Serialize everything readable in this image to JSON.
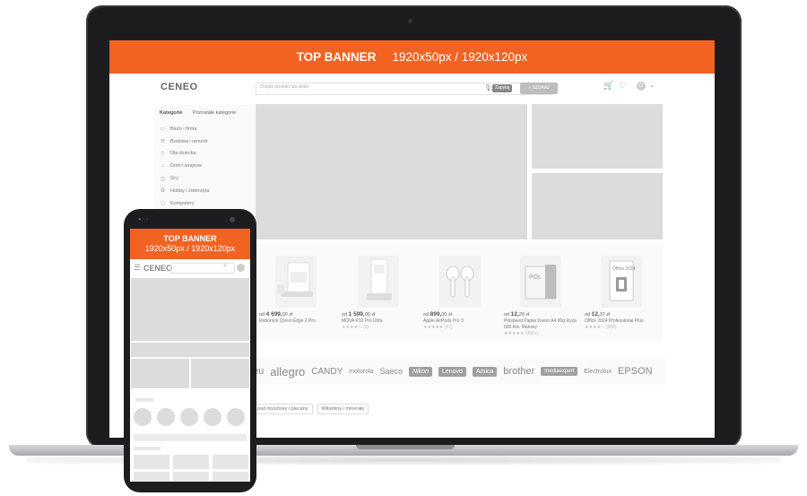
{
  "colors": {
    "banner": "#f26322",
    "placeholder": "#dcdcdc"
  },
  "desktop": {
    "banner": {
      "title": "TOP BANNER",
      "size": "1920x50px / 1920x120px"
    },
    "header": {
      "logo": "CENEO",
      "search_placeholder": "Znajdź produkt lub sklep",
      "ai_label": "Zapytaj",
      "search_button": "SZUKAJ",
      "user_initial": "D",
      "icons": [
        "cart-icon",
        "heart-icon",
        "user-icon",
        "chevron-down-icon",
        "mic-icon"
      ]
    },
    "sidebar": {
      "tab_categories": "Kategorie",
      "tab_other": "Pozostałe kategorie",
      "items": [
        {
          "label": "Biuro i firma",
          "icon": "briefcase-icon"
        },
        {
          "label": "Budowa i remont",
          "icon": "hammer-icon"
        },
        {
          "label": "Dla dziecka",
          "icon": "child-icon"
        },
        {
          "label": "Dom i wnętrze",
          "icon": "home-icon"
        },
        {
          "label": "Gry",
          "icon": "gamepad-icon"
        },
        {
          "label": "Hobby i zwierzęta",
          "icon": "paw-icon"
        },
        {
          "label": "Komputery",
          "icon": "monitor-icon"
        }
      ]
    },
    "products": [
      {
        "price_prefix": "od",
        "price_main": "4 699,",
        "price_cents": "00 zł",
        "name": "Roborock Qrevo Edge 2 Pro",
        "stars": "",
        "reviews": ""
      },
      {
        "price_prefix": "od",
        "price_main": "1 599,",
        "price_cents": "00 zł",
        "name": "MOVA P10 Pro Ultra",
        "stars": "★★★★☆",
        "reviews": "(3)"
      },
      {
        "price_prefix": "od",
        "price_main": "899,",
        "price_cents": "00 zł",
        "name": "Apple AirPods Pro 3",
        "stars": "★★★★★",
        "reviews": "(37)"
      },
      {
        "price_prefix": "od",
        "price_main": "12,",
        "price_cents": "29 zł",
        "name": "Polspeed Papier Ksero A4 80g Ryza 500 Ark. Matowy",
        "stars": "★★★★★",
        "reviews": "(999+)"
      },
      {
        "price_prefix": "od",
        "price_main": "12,",
        "price_cents": "37 zł",
        "name": "Office 2024 Professional Plus",
        "stars": "★★★★☆",
        "reviews": "(608)"
      }
    ],
    "brands": [
      "eu",
      "allegro",
      "CANDY",
      "motorola",
      "Saeco",
      "Nikon",
      "Lenovo",
      "Amica",
      "brother",
      "mediaexpert",
      "Electrolux",
      "EPSON"
    ],
    "chips": [
      "pad myszowy i plecany",
      "Witaminy i minerały"
    ]
  },
  "mobile": {
    "banner": {
      "title": "TOP BANNER",
      "size": "1920x50px / 1920x120px"
    },
    "header": {
      "logo": "CENEO",
      "icons": [
        "menu-icon",
        "search-icon",
        "avatar"
      ]
    }
  }
}
